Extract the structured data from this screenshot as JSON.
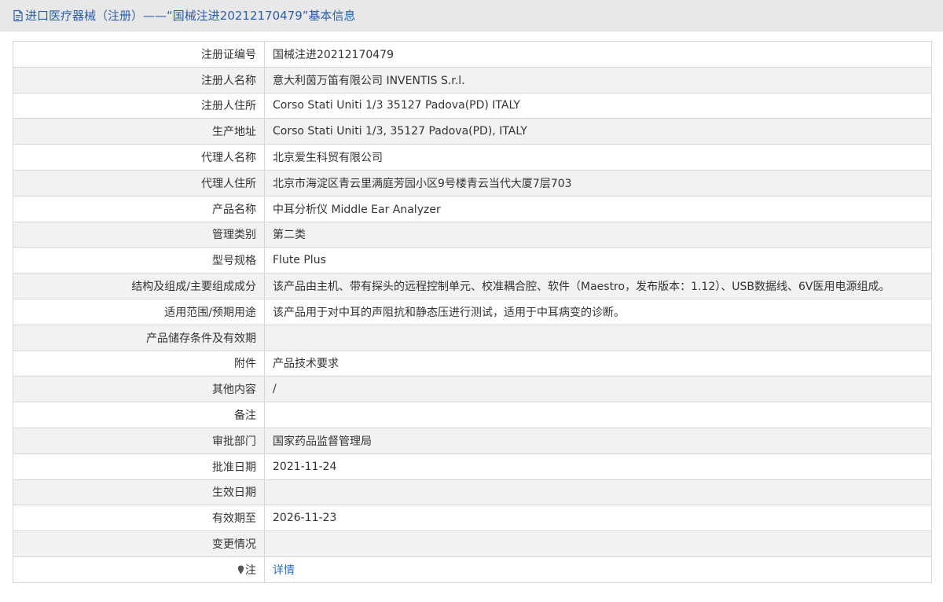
{
  "header": {
    "title": "进口医疗器械（注册）——“国械注进20212170479”基本信息",
    "icon": "document-icon"
  },
  "rows": [
    {
      "label": "注册证编号",
      "value": "国械注进20212170479"
    },
    {
      "label": "注册人名称",
      "value": "意大利茵万笛有限公司 INVENTIS S.r.l."
    },
    {
      "label": "注册人住所",
      "value": "Corso Stati Uniti 1/3 35127 Padova(PD) ITALY"
    },
    {
      "label": "生产地址",
      "value": "Corso Stati Uniti 1/3, 35127 Padova(PD), ITALY"
    },
    {
      "label": "代理人名称",
      "value": "北京爱生科贸有限公司"
    },
    {
      "label": "代理人住所",
      "value": "北京市海淀区青云里满庭芳园小区9号楼青云当代大厦7层703"
    },
    {
      "label": "产品名称",
      "value": "中耳分析仪 Middle Ear Analyzer"
    },
    {
      "label": "管理类别",
      "value": "第二类"
    },
    {
      "label": "型号规格",
      "value": "Flute Plus"
    },
    {
      "label": "结构及组成/主要组成成分",
      "value": "该产品由主机、带有探头的远程控制单元、校准耦合腔、软件（Maestro，发布版本：1.12）、USB数据线、6V医用电源组成。"
    },
    {
      "label": "适用范围/预期用途",
      "value": "该产品用于对中耳的声阻抗和静态压进行测试，适用于中耳病变的诊断。"
    },
    {
      "label": "产品储存条件及有效期",
      "value": ""
    },
    {
      "label": "附件",
      "value": "产品技术要求"
    },
    {
      "label": "其他内容",
      "value": "/"
    },
    {
      "label": "备注",
      "value": ""
    },
    {
      "label": "审批部门",
      "value": "国家药品监督管理局"
    },
    {
      "label": "批准日期",
      "value": "2021-11-24"
    },
    {
      "label": "生效日期",
      "value": ""
    },
    {
      "label": "有效期至",
      "value": "2026-11-23"
    },
    {
      "label": "变更情况",
      "value": ""
    }
  ],
  "note_row": {
    "label": "注",
    "icon": "pin-icon",
    "link_text": "详情"
  },
  "colors": {
    "title_text": "#2a5ea8",
    "link": "#2a6fc9",
    "title_bar_bg": "#e8e8e8",
    "even_row_bg": "#f2f2f2",
    "border": "#d6d6d6"
  }
}
